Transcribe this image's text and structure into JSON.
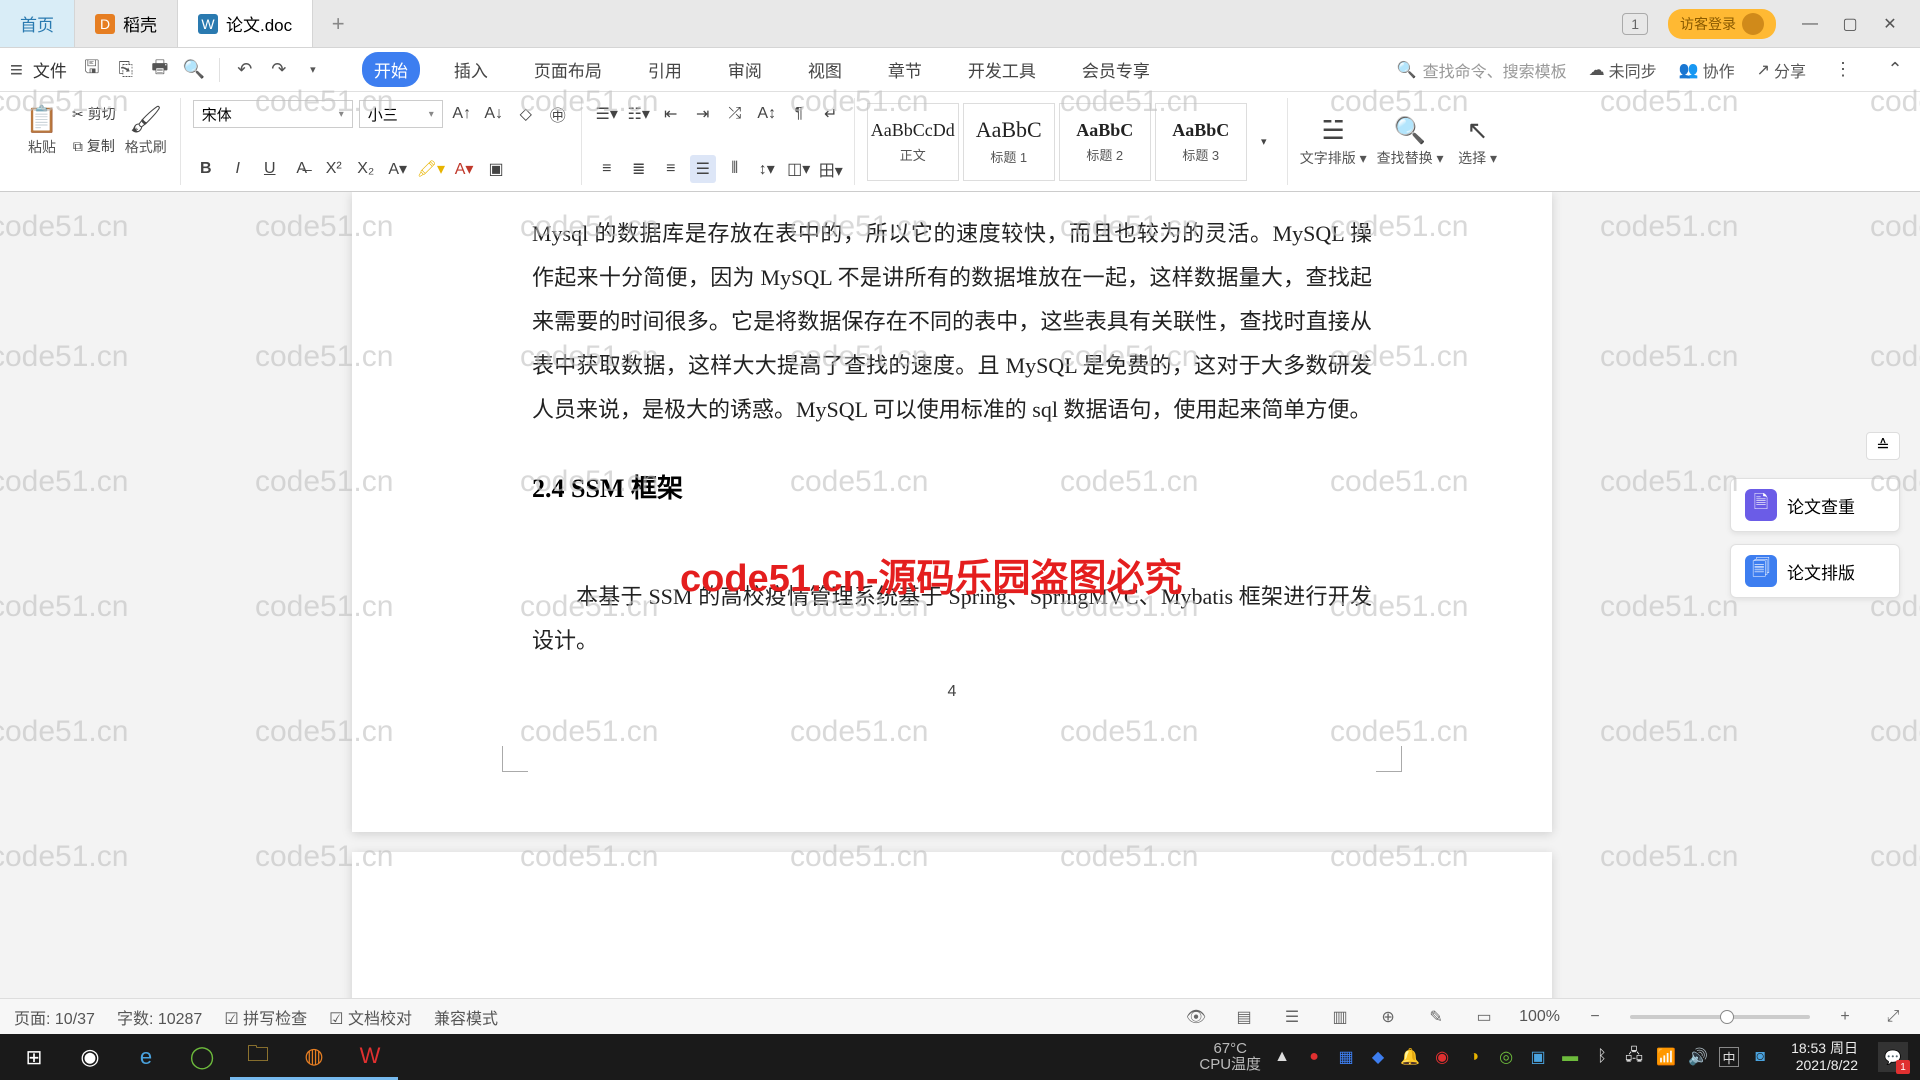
{
  "tabs": {
    "home": "首页",
    "t1": "稻壳",
    "t2": "论文.doc"
  },
  "titlebar": {
    "login": "访客登录",
    "one": "1"
  },
  "menubar": {
    "file": "文件",
    "items": [
      "开始",
      "插入",
      "页面布局",
      "引用",
      "审阅",
      "视图",
      "章节",
      "开发工具",
      "会员专享"
    ],
    "search_placeholder": "查找命令、搜索模板",
    "unsync": "未同步",
    "collab": "协作",
    "share": "分享"
  },
  "ribbon": {
    "paste": "粘贴",
    "cut": "剪切",
    "copy": "复制",
    "formatpainter": "格式刷",
    "font_name": "宋体",
    "font_size": "小三",
    "styles": {
      "preview": "AaBbCcDd",
      "preview2": "AaBbC",
      "preview3": "AaBbC",
      "preview4": "AaBbC",
      "s1": "正文",
      "s2": "标题 1",
      "s3": "标题 2",
      "s4": "标题 3"
    },
    "text_layout": "文字排版",
    "find_replace": "查找替换",
    "select": "选择"
  },
  "document": {
    "para": "Mysql 的数据库是存放在表中的，所以它的速度较快，而且也较为的灵活。MySQL 操作起来十分简便，因为 MySQL 不是讲所有的数据堆放在一起，这样数据量大，查找起来需要的时间很多。它是将数据保存在不同的表中，这些表具有关联性，查找时直接从表中获取数据，这样大大提高了查找的速度。且 MySQL 是免费的，这对于大多数研发人员来说，是极大的诱惑。MySQL 可以使用标准的 sql 数据语句，使用起来简单方便。",
    "heading": "2.4 SSM 框架",
    "para2": "本基于 SSM 的高校疫情管理系统基于 Spring、SpringMVC、Mybatis 框架进行开发设计。",
    "page_num": "4"
  },
  "watermark": "code51.cn",
  "redbanner": "code51.cn-源码乐园盗图必究",
  "sidepanel": {
    "check": "论文查重",
    "layout": "论文排版"
  },
  "statusbar": {
    "page": "页面: 10/37",
    "words": "字数: 10287",
    "spell": "拼写检查",
    "proof": "文档校对",
    "compat": "兼容模式",
    "zoom": "100%"
  },
  "taskbar": {
    "cpu_label": "CPU温度",
    "temp": "67°C",
    "ime": "中",
    "time": "18:53 周日",
    "date": "2021/8/22",
    "notif_count": "1"
  }
}
